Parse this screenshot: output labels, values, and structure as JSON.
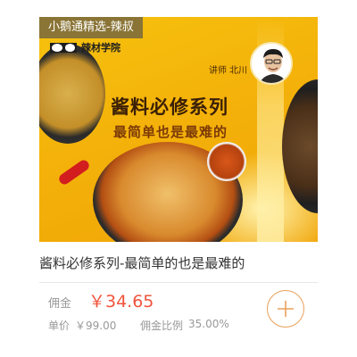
{
  "source_tag": "小鹅通精选-辣叔",
  "banner": {
    "brand_name": "辣材学院",
    "headline": "酱料必修系列",
    "subline": "最简单也是最难的",
    "teacher": "讲师 北川"
  },
  "product": {
    "title": "酱料必修系列-最简单的也是最难的",
    "commission_label": "佣金",
    "commission_value": "￥34.65",
    "unit_price_label": "单价",
    "unit_price_value": "￥99.00",
    "commission_rate_label": "佣金比例",
    "commission_rate_value": "35.00%"
  },
  "colors": {
    "accent_price": "#f0543d",
    "add_button_ring": "#e9a05a",
    "banner_yellow": "#f4b20a"
  },
  "icons": {
    "add": "plus-icon"
  }
}
